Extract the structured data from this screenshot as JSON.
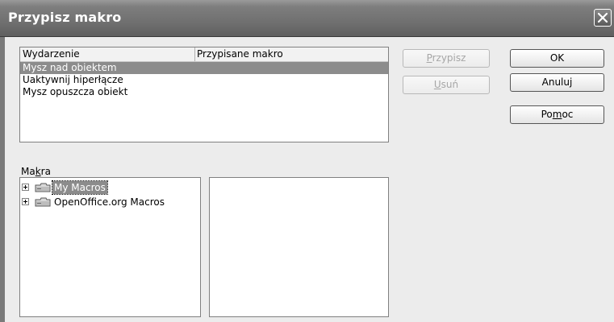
{
  "window": {
    "title": "Przypisz makro",
    "close_icon": "close-icon"
  },
  "events_table": {
    "columns": [
      "Wydarzenie",
      "Przypisane makro"
    ],
    "rows": [
      {
        "event": "Mysz nad obiektem",
        "macro": "",
        "selected": true
      },
      {
        "event": "Uaktywnij hiperłącze",
        "macro": "",
        "selected": false
      },
      {
        "event": "Mysz opuszcza obiekt",
        "macro": "",
        "selected": false
      }
    ]
  },
  "actions": {
    "assign": {
      "pre": "",
      "ul": "P",
      "post": "rzypisz",
      "enabled": false
    },
    "remove": {
      "pre": "",
      "ul": "U",
      "post": "suń",
      "enabled": false
    }
  },
  "buttons": {
    "ok": "OK",
    "cancel": "Anuluj",
    "help": {
      "pre": "Po",
      "ul": "m",
      "post": "oc"
    }
  },
  "macros": {
    "label": {
      "pre": "Ma",
      "ul": "k",
      "post": "ra"
    },
    "tree": [
      {
        "label": "My Macros",
        "selected": true,
        "icon": "folder-icon"
      },
      {
        "label": "OpenOffice.org Macros",
        "selected": false,
        "icon": "folder-icon"
      }
    ],
    "commands": []
  }
}
